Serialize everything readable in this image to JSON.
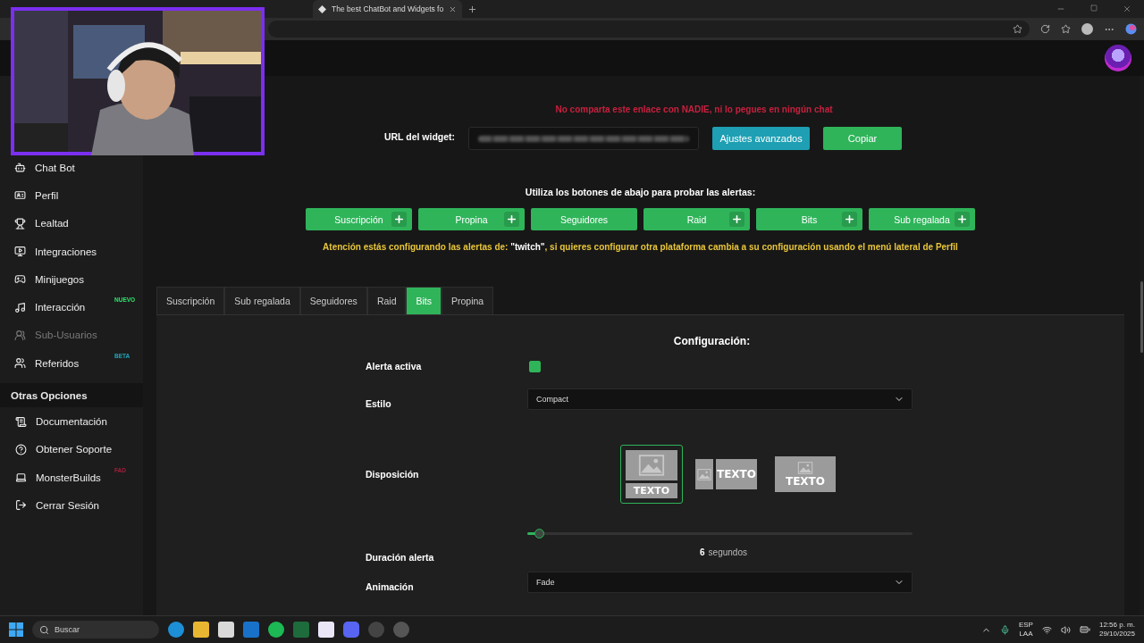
{
  "browser": {
    "tabs": [
      {
        "title": "The best ChatBot and Widgets fo",
        "selected": true
      }
    ]
  },
  "sidebar": {
    "items": [
      {
        "label": "Chat Bot",
        "disabled": false
      },
      {
        "label": "Perfil",
        "disabled": false
      },
      {
        "label": "Lealtad",
        "disabled": false
      },
      {
        "label": "Integraciones",
        "disabled": false
      },
      {
        "label": "Minijuegos",
        "disabled": false
      },
      {
        "label": "Interacción",
        "disabled": false,
        "badge": {
          "text": "NUEVO",
          "color": "#2ee66b"
        }
      },
      {
        "label": "Sub-Usuarios",
        "disabled": true
      },
      {
        "label": "Referidos",
        "disabled": false,
        "badge": {
          "text": "BETA",
          "color": "#1fa6b8"
        }
      }
    ],
    "section_title": "Otras Opciones",
    "other_items": [
      {
        "label": "Documentación",
        "disabled": false
      },
      {
        "label": "Obtener Soporte",
        "disabled": false
      },
      {
        "label": "MonsterBuilds",
        "disabled": false,
        "badge": {
          "text": "FAD",
          "color": "#a0203a"
        }
      },
      {
        "label": "Cerrar Sesión",
        "disabled": false
      }
    ]
  },
  "warning": "No comparta este enlace con NADIE, ni lo pegues en ningún chat",
  "widget_url": {
    "label": "URL del widget:",
    "advanced_button": "Ajustes avanzados",
    "copy_button": "Copiar"
  },
  "test_prompt": "Utiliza los botones de abajo para probar las alertas:",
  "test_buttons": [
    {
      "label": "Suscripción",
      "has_plus": true
    },
    {
      "label": "Propina",
      "has_plus": true
    },
    {
      "label": "Seguidores",
      "has_plus": false
    },
    {
      "label": "Raid",
      "has_plus": true
    },
    {
      "label": "Bits",
      "has_plus": true
    },
    {
      "label": "Sub regalada",
      "has_plus": true
    }
  ],
  "notice": "Atención estás configurando las alertas de: **\"twitch\"**, si quieres configurar otra plataforma cambia a su configuración usando el menú lateral de Perfil",
  "tabs": [
    {
      "label": "Suscripción",
      "selected": false
    },
    {
      "label": "Sub regalada",
      "selected": false
    },
    {
      "label": "Seguidores",
      "selected": false
    },
    {
      "label": "Raid",
      "selected": false
    },
    {
      "label": "Bits",
      "selected": true
    },
    {
      "label": "Propina",
      "selected": false
    }
  ],
  "config": {
    "title": "Configuración:",
    "fields": [
      {
        "kind": "checkbox",
        "label": "Alerta activa",
        "checked": true
      },
      {
        "kind": "select",
        "label": "Estilo",
        "value": "Compact"
      },
      {
        "kind": "layout",
        "label": "Disposición",
        "options": [
          {
            "kind": "stacked",
            "text": "TEXTO",
            "selected": true
          },
          {
            "kind": "side",
            "text": "TEXTO",
            "selected": false
          },
          {
            "kind": "overlay",
            "text": "TEXTO",
            "selected": false
          }
        ]
      },
      {
        "kind": "slider",
        "label": "Duración alerta",
        "level": 0.03,
        "value": "6",
        "unit": "segundos"
      },
      {
        "kind": "select",
        "label": "Animación",
        "value": "Fade"
      }
    ]
  },
  "taskbar": {
    "search_placeholder": "Buscar",
    "language": "ESP",
    "region": "LAA",
    "time": "12:56 p. m.",
    "date": "29/10/2025"
  }
}
